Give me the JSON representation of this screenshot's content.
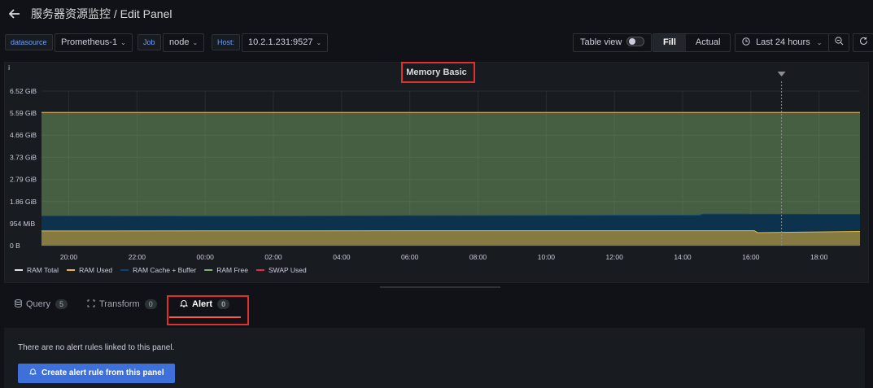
{
  "header": {
    "title": "服务器资源监控 / Edit Panel"
  },
  "variables": [
    {
      "label": "datasource",
      "value": "Prometheus-1"
    },
    {
      "label": "Job",
      "value": "node"
    },
    {
      "label": "Host:",
      "value": "10.2.1.231:9527"
    }
  ],
  "toolbar": {
    "table_view_label": "Table view",
    "fill_label": "Fill",
    "actual_label": "Actual",
    "time_range": "Last 24 hours"
  },
  "panel": {
    "info_label": "i"
  },
  "colors": {
    "ram_total": "#e0e0e0",
    "ram_used": "#eab839",
    "ram_cache": "#0a437c",
    "ram_free": "#7eb26d",
    "swap_used": "#e02f44"
  },
  "chart_data": {
    "type": "area",
    "title": "Memory Basic",
    "y_unit": "GiB",
    "y_ticks": [
      "0 B",
      "954 MiB",
      "1.86 GiB",
      "2.79 GiB",
      "3.73 GiB",
      "4.66 GiB",
      "5.59 GiB",
      "6.52 GiB"
    ],
    "y_tick_values": [
      0,
      0.932,
      1.86,
      2.79,
      3.73,
      4.66,
      5.59,
      6.52
    ],
    "ylim": [
      0,
      6.52
    ],
    "x_ticks": [
      "20:00",
      "22:00",
      "00:00",
      "02:00",
      "04:00",
      "06:00",
      "08:00",
      "10:00",
      "12:00",
      "14:00",
      "16:00",
      "18:00"
    ],
    "x_tick_hours": [
      0,
      2,
      4,
      6,
      8,
      10,
      12,
      14,
      16,
      18,
      20,
      22
    ],
    "xlim_hours": [
      -0.8,
      23.2
    ],
    "grid": true,
    "legend_placement": "bottom-left",
    "series": [
      {
        "name": "RAM Total",
        "color": "#e0e0e0",
        "hours": [
          -0.8,
          23.2
        ],
        "values": [
          5.62,
          5.62
        ]
      },
      {
        "name": "RAM Used",
        "color": "#eab839",
        "hours": [
          -0.8,
          10,
          20.1,
          20.2,
          23.2
        ],
        "values": [
          0.62,
          0.63,
          0.63,
          0.55,
          0.6
        ]
      },
      {
        "name": "RAM Cache + Buffer",
        "color": "#0a437c",
        "hours": [
          -0.8,
          5,
          10,
          18.5,
          18.6,
          23.2
        ],
        "values": [
          1.25,
          1.24,
          1.26,
          1.28,
          1.33,
          1.32
        ]
      },
      {
        "name": "RAM Free",
        "color": "#7eb26d",
        "hours": [
          -0.8,
          23.2
        ],
        "values": [
          5.62,
          5.62
        ]
      },
      {
        "name": "SWAP Used",
        "color": "#e02f44",
        "hours": [
          -0.8,
          23.2
        ],
        "values": [
          0,
          0
        ]
      }
    ],
    "annotation_hour": 20.9
  },
  "editor_tabs": [
    {
      "label": "Query",
      "count": "5"
    },
    {
      "label": "Transform",
      "count": "0"
    },
    {
      "label": "Alert",
      "count": "0"
    }
  ],
  "alert": {
    "message": "There are no alert rules linked to this panel.",
    "create_button": "Create alert rule from this panel"
  }
}
